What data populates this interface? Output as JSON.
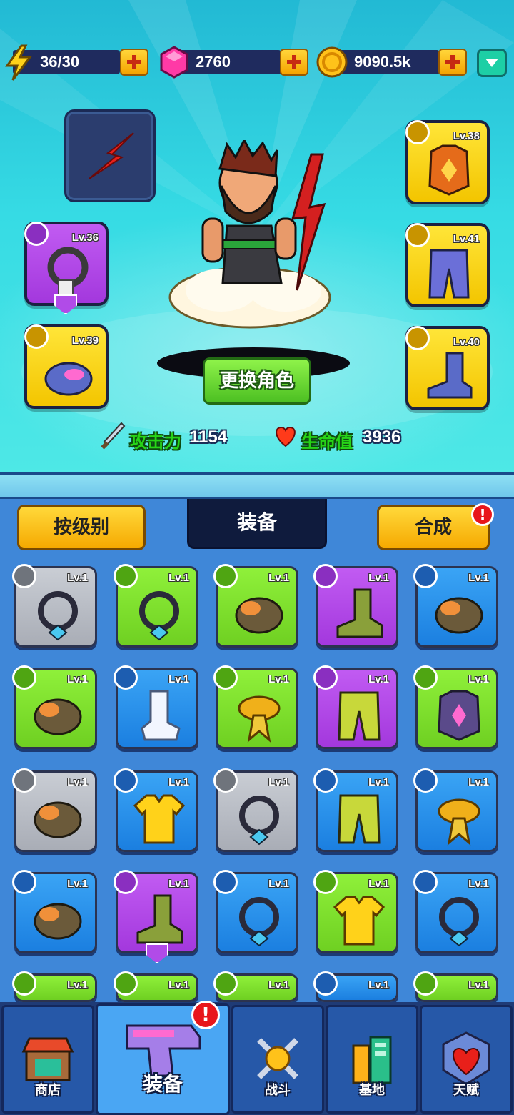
{
  "resources": {
    "energy": "36/30",
    "gems": "2760",
    "coins": "9090.5k"
  },
  "hero": {
    "swap_label": "更换角色",
    "attack_label": "攻击力",
    "attack_value": "1154",
    "hp_label": "生命值",
    "hp_value": "3936"
  },
  "equipped": {
    "necklace_level": "Lv.36",
    "glove_level": "Lv.39",
    "armor_level": "Lv.38",
    "pants_level": "Lv.41",
    "boots_level": "Lv.40"
  },
  "tabs": {
    "sort_label": "按级别",
    "equip_label": "装备",
    "merge_label": "合成",
    "merge_alert": "!"
  },
  "inventory": {
    "level_text": "Lv.1",
    "rows": [
      [
        {
          "item": "necklace-icon",
          "rarity": "gray"
        },
        {
          "item": "necklace-icon",
          "rarity": "green"
        },
        {
          "item": "glove-icon",
          "rarity": "green"
        },
        {
          "item": "boots-icon",
          "rarity": "purple"
        },
        {
          "item": "glove-icon",
          "rarity": "blue"
        }
      ],
      [
        {
          "item": "glove-icon",
          "rarity": "green"
        },
        {
          "item": "sock-icon",
          "rarity": "blue"
        },
        {
          "item": "scarf-icon",
          "rarity": "green"
        },
        {
          "item": "pants-icon",
          "rarity": "purple"
        },
        {
          "item": "armor-icon",
          "rarity": "green"
        }
      ],
      [
        {
          "item": "glove-icon",
          "rarity": "gray"
        },
        {
          "item": "shirt-icon",
          "rarity": "blue"
        },
        {
          "item": "necklace-icon",
          "rarity": "gray"
        },
        {
          "item": "pants-icon",
          "rarity": "blue"
        },
        {
          "item": "scarf-icon",
          "rarity": "blue"
        }
      ],
      [
        {
          "item": "glove-icon",
          "rarity": "blue"
        },
        {
          "item": "boots-icon",
          "rarity": "purple"
        },
        {
          "item": "necklace-icon",
          "rarity": "blue"
        },
        {
          "item": "shirt-icon",
          "rarity": "green"
        },
        {
          "item": "necklace-icon",
          "rarity": "blue"
        }
      ]
    ]
  },
  "nav": {
    "shop": "商店",
    "equipment": "装备",
    "battle": "战斗",
    "base": "基地",
    "talent": "天赋",
    "equipment_alert": "!"
  },
  "colors": {
    "accent_yellow": "#f5c400",
    "hero_bg": "#36dbe4",
    "panel_bg": "#3f87d8",
    "nav_bg": "#1f3b76"
  }
}
